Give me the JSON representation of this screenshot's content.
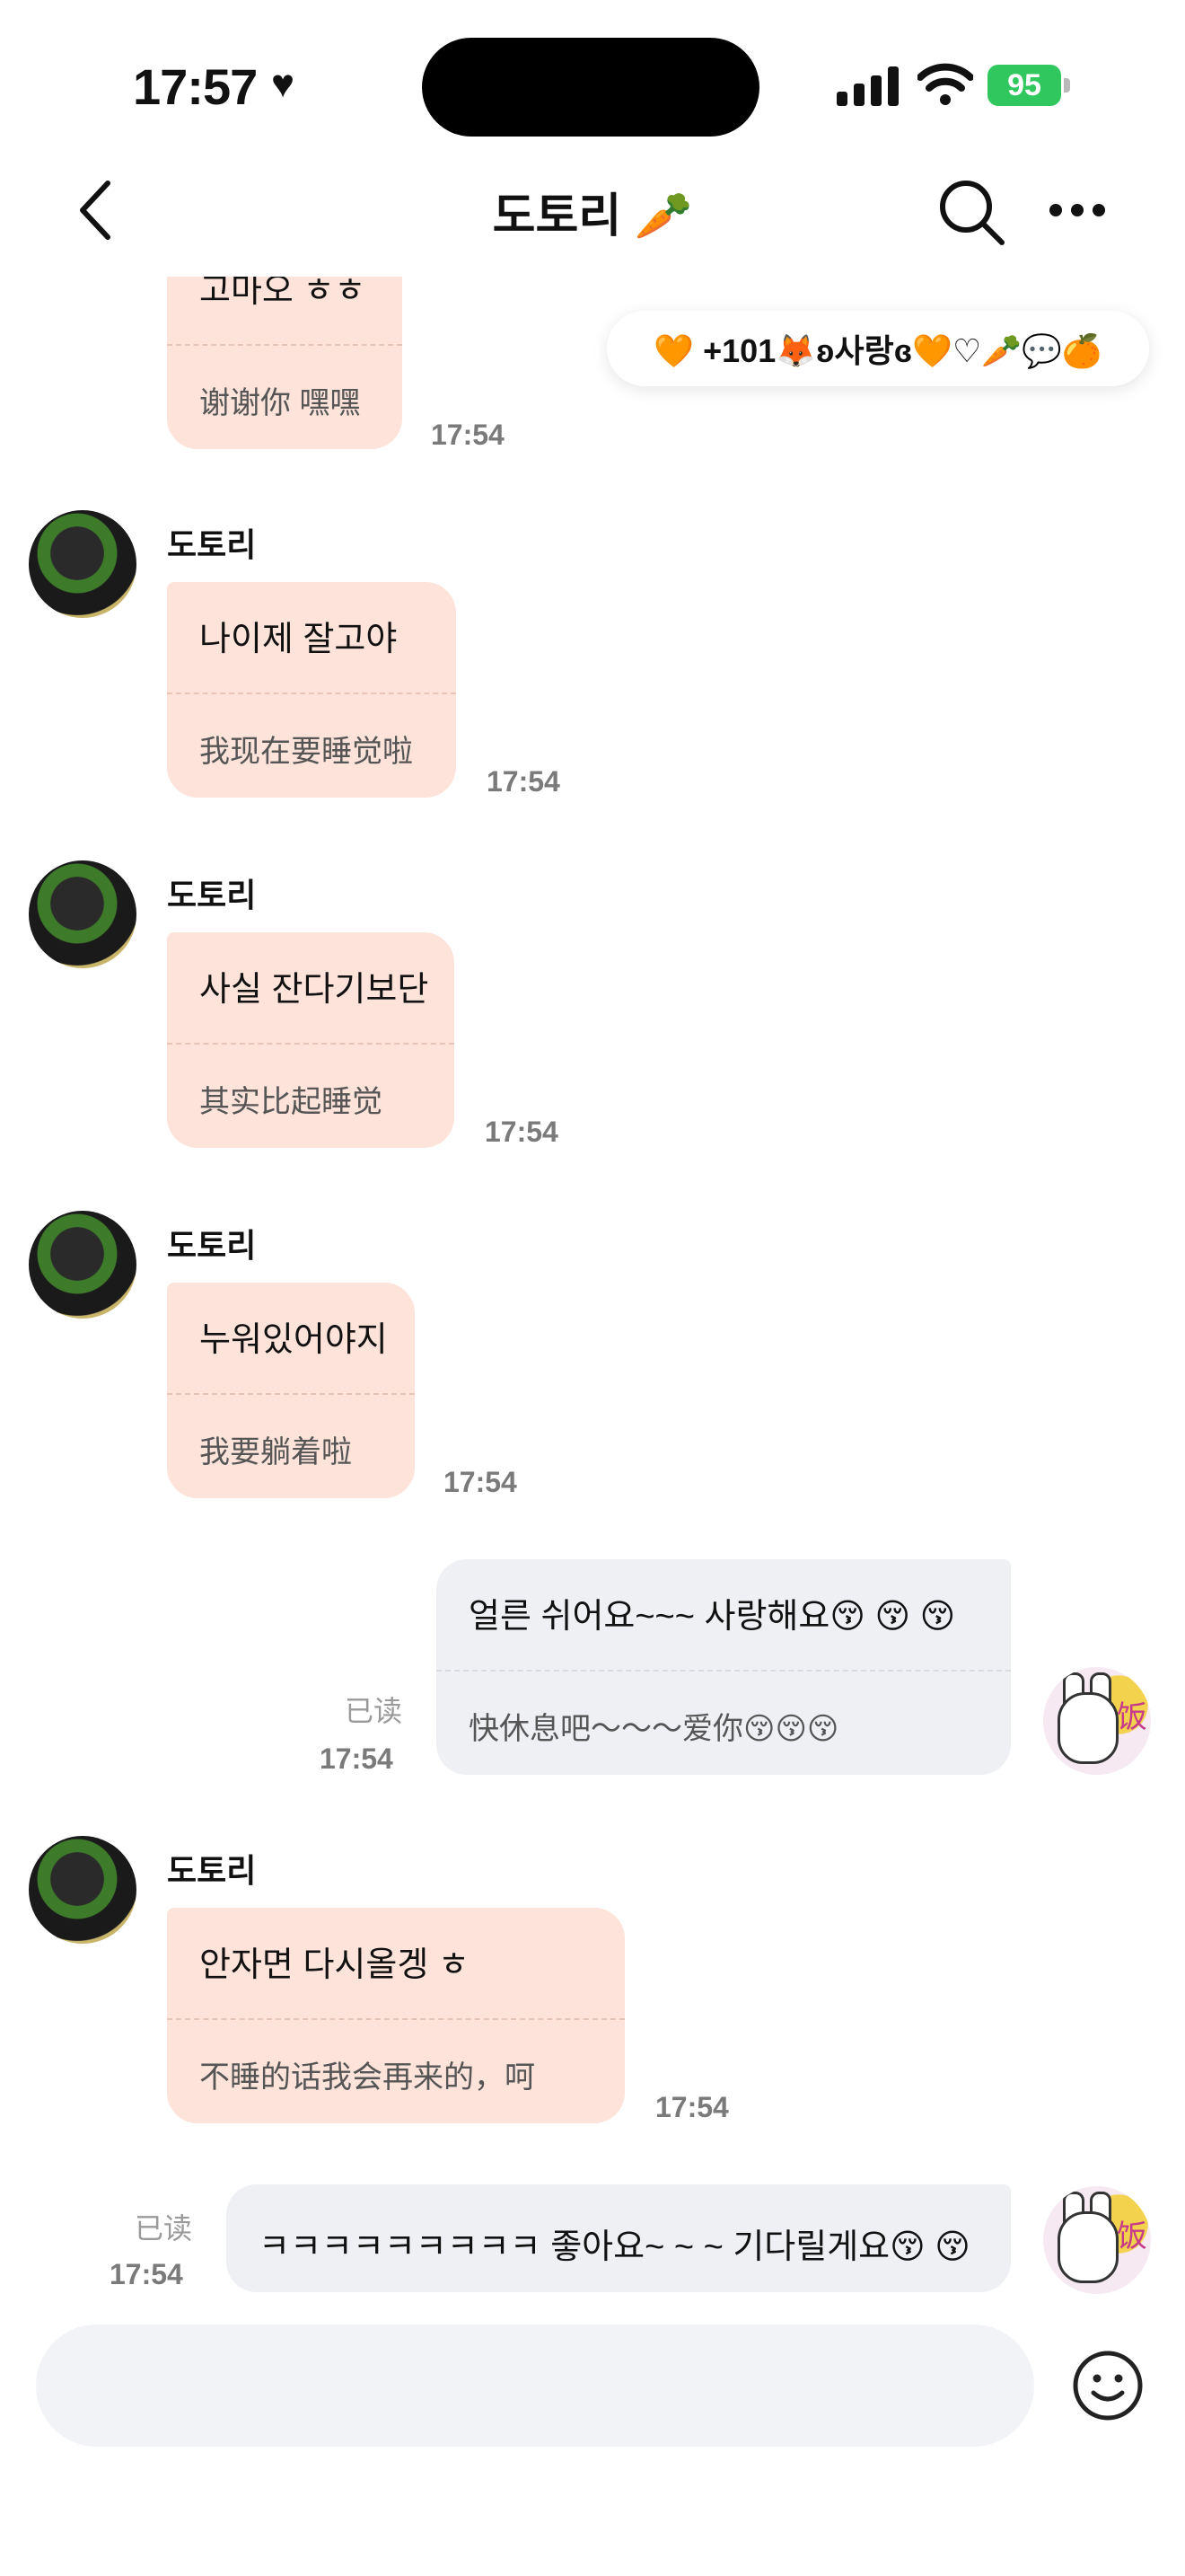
{
  "status_bar": {
    "time": "17:57",
    "heart": "♥",
    "battery": "95"
  },
  "nav": {
    "title": "도토리 🥕"
  },
  "reaction_pill": {
    "text": "🧡 +101🦊ʚ사랑ɞ🧡♡🥕💬🍊"
  },
  "partial_message": {
    "korean": "고마오 ㅎㅎ",
    "chinese": "谢谢你 嘿嘿",
    "time": "17:54"
  },
  "messages": [
    {
      "sender": "도토리",
      "korean": "나이제 잘고야",
      "chinese": "我现在要睡觉啦",
      "time": "17:54"
    },
    {
      "sender": "도토리",
      "korean": "사실 잔다기보단",
      "chinese": "其实比起睡觉",
      "time": "17:54"
    },
    {
      "sender": "도토리",
      "korean": "누워있어야지",
      "chinese": "我要躺着啦",
      "time": "17:54"
    }
  ],
  "my_message_1": {
    "korean": "얼른 쉬어요~~~ 사랑해요😚 😚 😚",
    "chinese": "快休息吧～～～爱你😚😚😚",
    "read": "已读",
    "time": "17:54"
  },
  "message_4": {
    "sender": "도토리",
    "korean": "안자면 다시올겡 ㅎ",
    "chinese": "不睡的话我会再来的，呵",
    "time": "17:54"
  },
  "my_message_2": {
    "text": "ㅋㅋㅋㅋㅋㅋㅋㅋㅋ 좋아요~ ~ ~ 기다릴게요😚 😚",
    "read": "已读",
    "time": "17:54"
  },
  "my_avatar": {
    "glyph": "饭"
  }
}
